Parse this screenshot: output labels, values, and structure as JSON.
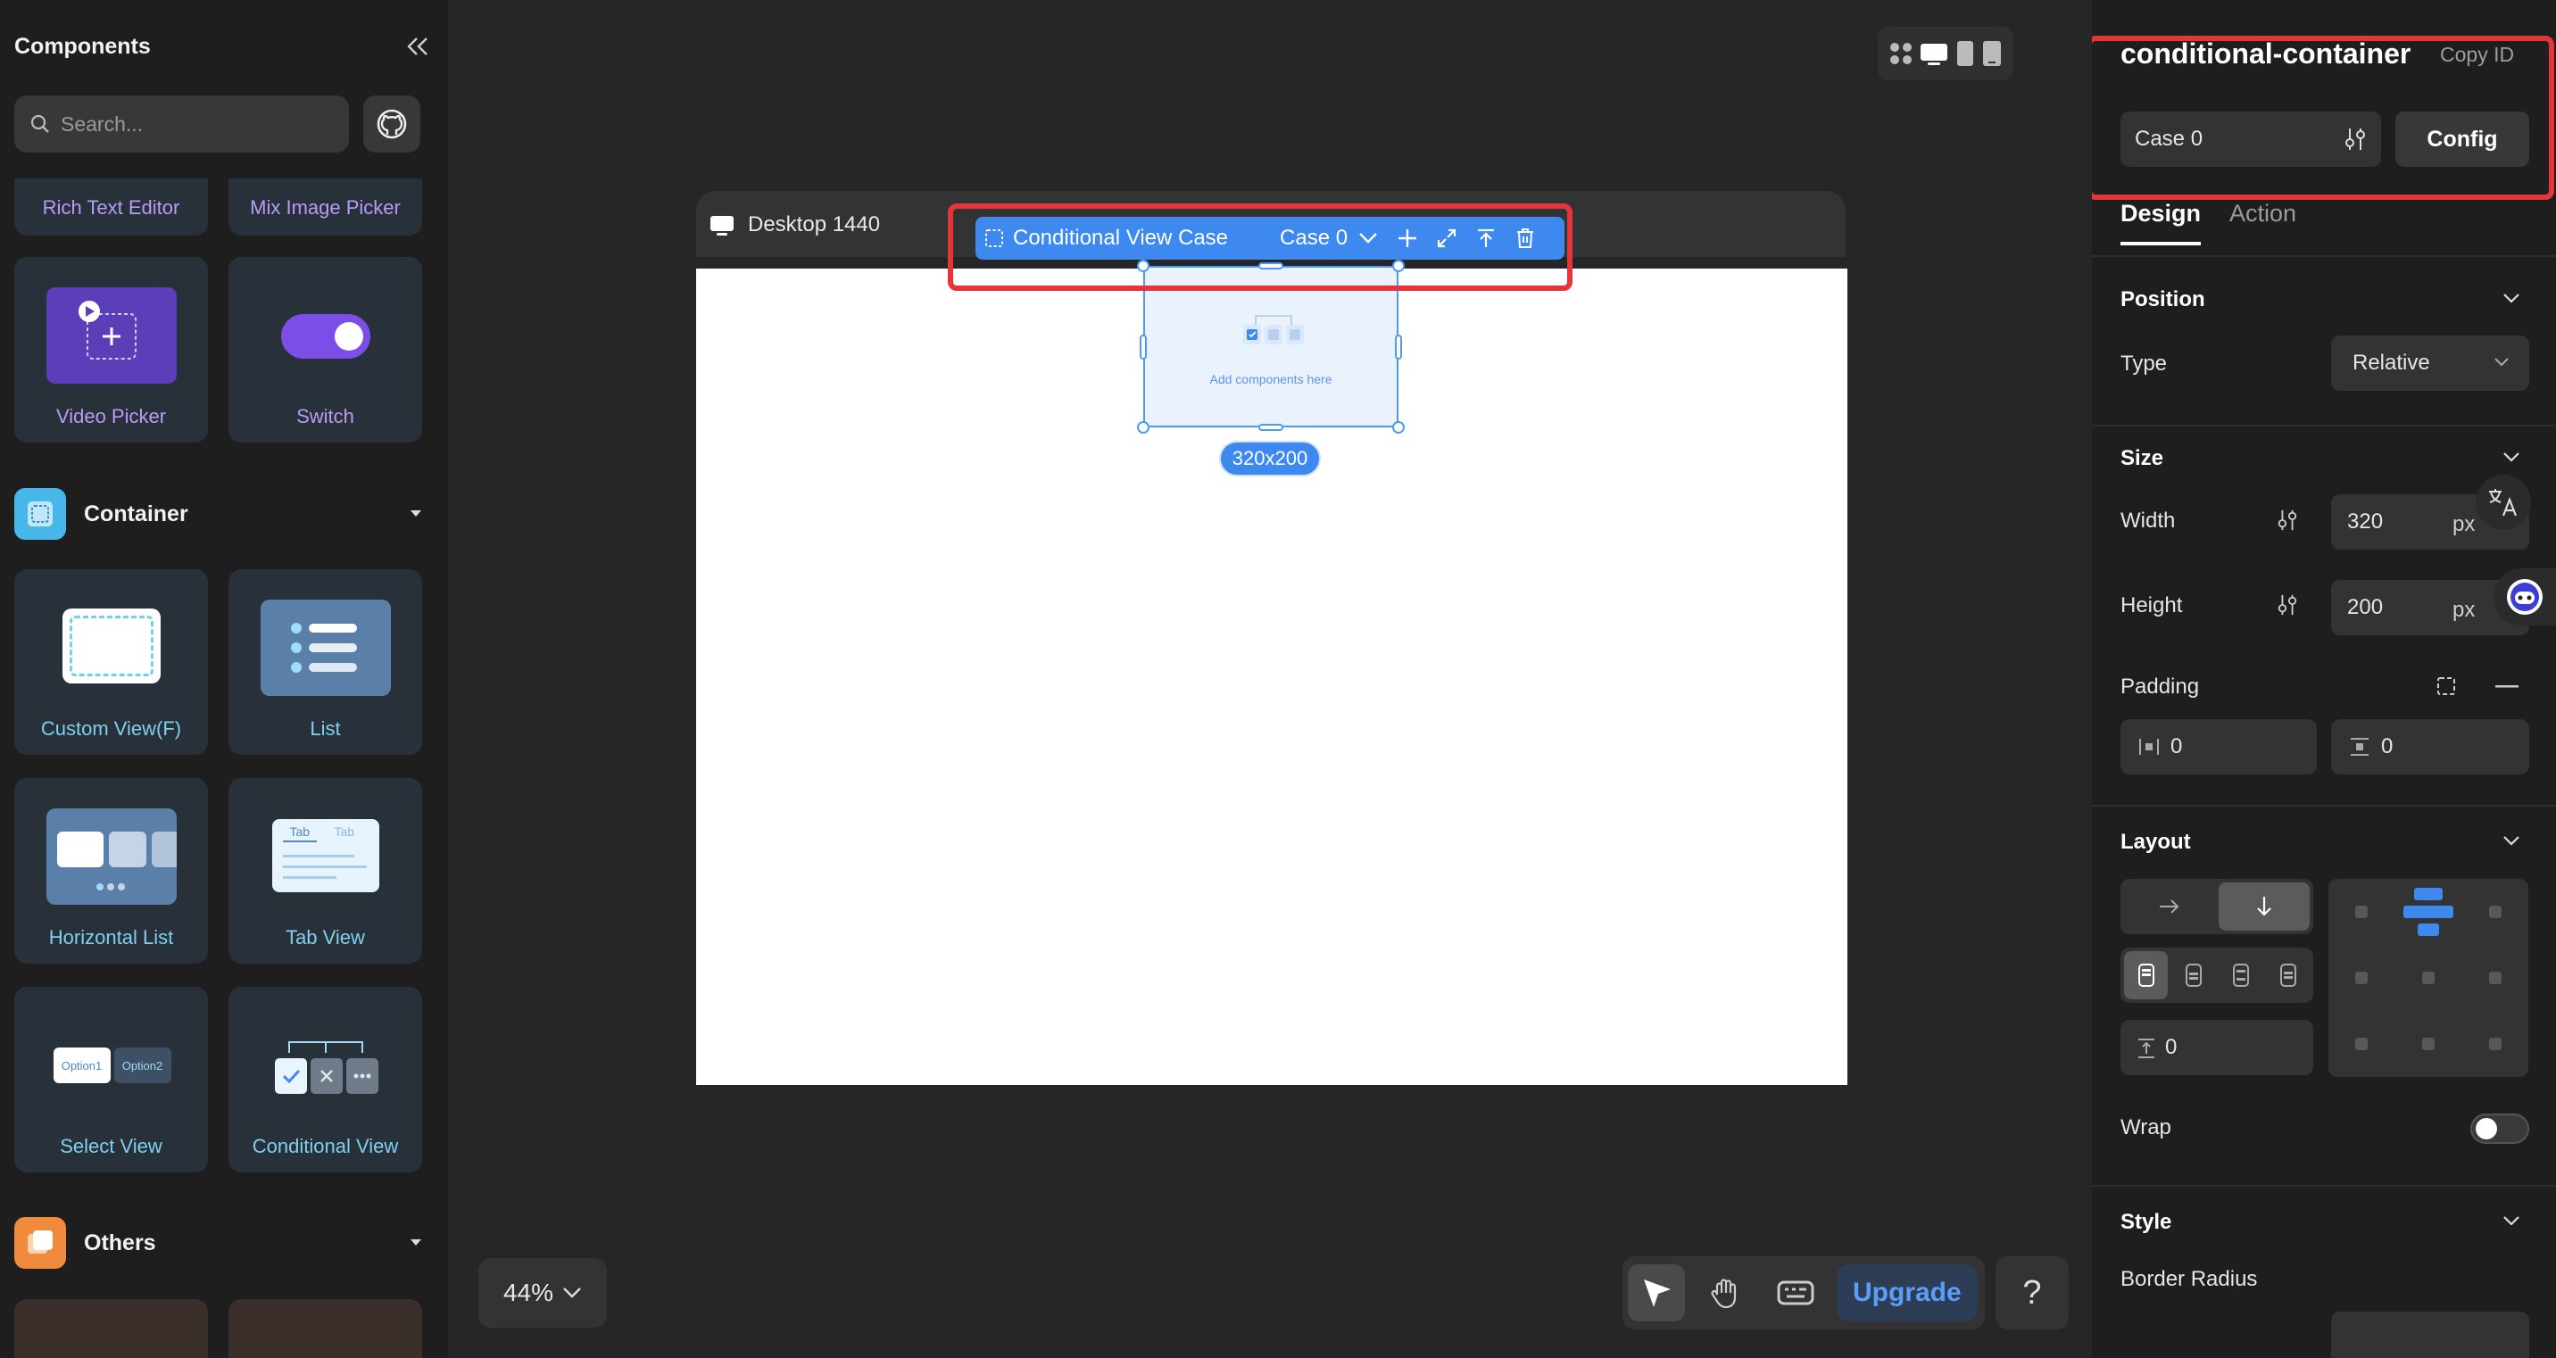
{
  "left_panel": {
    "title": "Components",
    "search_placeholder": "Search...",
    "top_cards": [
      "Rich Text Editor",
      "Mix Image Picker"
    ],
    "cards_row1": [
      "Video Picker",
      "Switch"
    ],
    "container_section": "Container",
    "container_cards": [
      "Custom View(F)",
      "List",
      "Horizontal List",
      "Tab View",
      "Select View",
      "Conditional View"
    ],
    "select_view_options": [
      "Option1",
      "Option2"
    ],
    "tab_view_tabs": [
      "Tab",
      "Tab"
    ],
    "others_section": "Others"
  },
  "canvas": {
    "frame_name": "Desktop 1440",
    "toolbar_label": "Conditional View Case",
    "toolbar_case": "Case 0",
    "placeholder_text": "Add components here",
    "size_badge": "320x200",
    "zoom": "44%",
    "upgrade_label": "Upgrade",
    "help_label": "?"
  },
  "right_panel": {
    "title": "conditional-container",
    "copy_id": "Copy ID",
    "case_value": "Case 0",
    "config_label": "Config",
    "tabs": [
      "Design",
      "Action"
    ],
    "position": {
      "title": "Position",
      "type_label": "Type",
      "type_value": "Relative"
    },
    "size": {
      "title": "Size",
      "width_label": "Width",
      "width_value": "320",
      "width_unit": "px",
      "height_label": "Height",
      "height_value": "200",
      "height_unit": "px",
      "padding_label": "Padding",
      "padding_h": "0",
      "padding_v": "0"
    },
    "layout": {
      "title": "Layout",
      "gap_value": "0",
      "wrap_label": "Wrap",
      "wrap_on": false
    },
    "style": {
      "title": "Style",
      "border_radius_label": "Border Radius"
    }
  },
  "colors": {
    "accent": "#3d89f0",
    "highlight": "#e5353c",
    "purple": "#7b4ee8"
  }
}
